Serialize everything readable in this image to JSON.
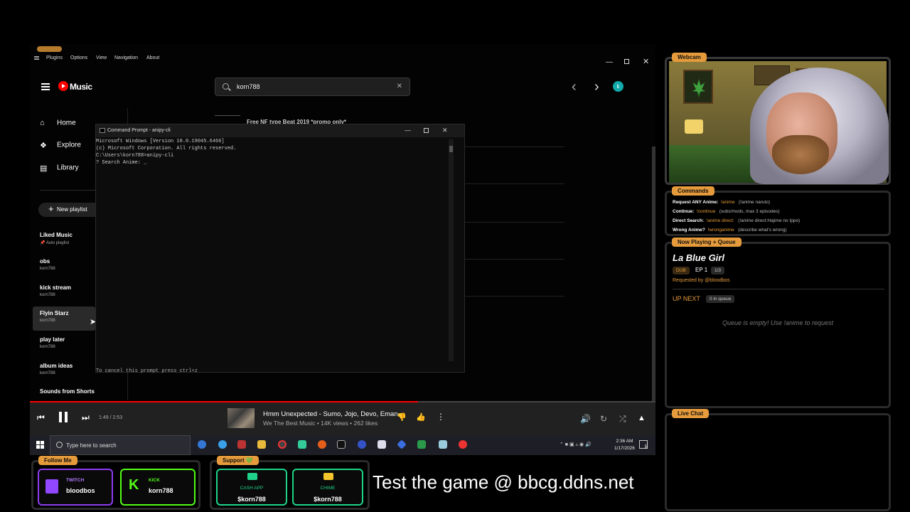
{
  "menubar": {
    "items": [
      "Plugins",
      "Options",
      "View",
      "Navigation",
      "About"
    ]
  },
  "ytmusic": {
    "logo_text": "Music",
    "search_value": "korn788",
    "avatar_letter": "k",
    "nav": [
      {
        "label": "Home",
        "icon": "home-icon"
      },
      {
        "label": "Explore",
        "icon": "compass-icon"
      },
      {
        "label": "Library",
        "icon": "library-icon"
      }
    ],
    "new_playlist": "New playlist",
    "playlists": [
      {
        "name": "Liked Music",
        "sub": "Auto playlist"
      },
      {
        "name": "obs",
        "sub": "korn788"
      },
      {
        "name": "kick stream",
        "sub": "korn788"
      },
      {
        "name": "Flyin Starz",
        "sub": "korn788"
      },
      {
        "name": "play later",
        "sub": "korn788"
      },
      {
        "name": "album ideas",
        "sub": "korn788"
      },
      {
        "name": "Sounds from Shorts",
        "sub": ""
      }
    ],
    "content_top": "Free NF type Beat 2019 *promo only*"
  },
  "cmd": {
    "title": "Command Prompt - anipy-cli",
    "lines": [
      "Microsoft Windows [Version 10.0.19045.6466]",
      "(c) Microsoft Corporation. All rights reserved.",
      "",
      "C:\\Users\\korn788>anipy-cli",
      "? Search Anime: _"
    ],
    "cancel_hint": "To cancel this prompt press ctrl+z"
  },
  "player": {
    "progress": 0.62,
    "time": "1:49 / 2:53",
    "title": "Hmm Unexpected - Sumo, Jojo, Devo, Eman",
    "subtitle": "We The Best Music • 14K views • 262 likes"
  },
  "taskbar": {
    "search_placeholder": "Type here to search",
    "time": "2:36 AM",
    "date": "1/17/2026",
    "notifications": "5"
  },
  "overlay": {
    "webcam_label": "Webcam",
    "commands_label": "Commands",
    "commands": [
      {
        "label": "Request ANY Anime:",
        "cmd": "!anime",
        "desc": "(!anime naruto)"
      },
      {
        "label": "Continue:",
        "cmd": "!continue",
        "desc": "(subs/mods, max 3 episodes)"
      },
      {
        "label": "Direct Search:",
        "cmd": "!anime direct:",
        "desc": "(!anime direct:Hajime no Ippo)"
      },
      {
        "label": "Wrong Anime?",
        "cmd": "!wronganime",
        "desc": "(describe what's wrong)"
      }
    ],
    "nowplaying_label": "Now Playing + Queue",
    "anime_title": "La Blue Girl",
    "badge_dub": "DUB",
    "episode": "EP 1",
    "episode_count": "1/3",
    "requested_by": "Requested by @bloodbos",
    "up_next": "UP NEXT",
    "queue_count": "0 in queue",
    "queue_empty": "Queue is empty! Use !anime to request",
    "livechat_label": "Live Chat",
    "follow_label": "Follow Me",
    "twitch_label": "TWITCH",
    "twitch_user": "bloodbos",
    "kick_label": "KICK",
    "kick_user": "korn788",
    "support_label": "Support 💚",
    "cashapp_label": "CASH APP",
    "cashapp_user": "$korn788",
    "chime_label": "CHIME",
    "chime_user": "$korn788",
    "banner": "Test the game @ bbcg.ddns.net"
  }
}
